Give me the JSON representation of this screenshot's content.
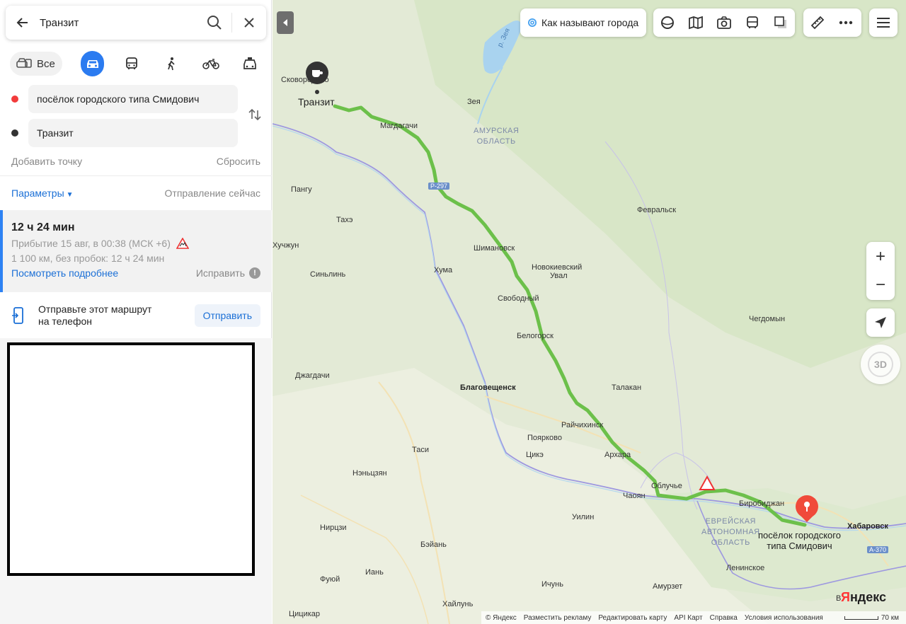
{
  "search": {
    "query": "Транзит"
  },
  "modes": {
    "all_label": "Все"
  },
  "route_from": "посёлок городского типа Смидович",
  "route_to": "Транзит",
  "add_point": "Добавить точку",
  "reset": "Сбросить",
  "parameters": "Параметры",
  "departure": "Отправление сейчас",
  "route": {
    "duration": "12 ч 24 мин",
    "arrival": "Прибытие 15 авг, в 00:38 (МСК +6)",
    "distance": "1 100 км, без пробок: 12 ч 24 мин",
    "details_link": "Посмотреть подробнее",
    "fix_label": "Исправить"
  },
  "send": {
    "text_line1": "Отправьте этот маршрут",
    "text_line2": "на телефон",
    "button": "Отправить"
  },
  "map": {
    "promo_label": "Как называют города",
    "origin_label": "Транзит",
    "dest_label_line1": "посёлок городского",
    "dest_label_line2": "типа Смидович",
    "road_badge": "Р-297",
    "road_badge2": "А-370",
    "compass_label": "3D",
    "logo_y": "Я",
    "logo_rest": "ндекс",
    "scale_label": "70 км",
    "footer": [
      "© Яндекс",
      "Разместить рекламу",
      "Редактировать карту",
      "API Карт",
      "Справка",
      "Условия использования"
    ],
    "cities": {
      "skovorodino": "Сковородино",
      "zeya": "Зея",
      "magdagachi": "Магдагачи",
      "pangu": "Пангу",
      "tahe": "Тахэ",
      "huzhun": "Хучжун",
      "sinlin": "Синьлинь",
      "huma": "Хума",
      "shimanovsk": "Шимановск",
      "novokievsky": "Новокиевский",
      "uval": "Увал",
      "svobodny": "Свободный",
      "belogorsk": "Белогорск",
      "fevralsk": "Февральск",
      "chegdomyn": "Чегдомын",
      "dzhagdachi": "Джагдачи",
      "blagoveshchensk": "Благовещенск",
      "talakan": "Талакан",
      "raichikhinsk": "Райчихинск",
      "poyarkovo": "Поярково",
      "tsike": "Цикэ",
      "tasi": "Таси",
      "arhara": "Архара",
      "neniszyan": "Нэньцзян",
      "chaoyan": "Чаоян",
      "obluchye": "Облучье",
      "birobidzhan": "Биробиджан",
      "khabarovsk": "Хабаровск",
      "uilin": "Уилин",
      "nirtszi": "Нирцзи",
      "beyan": "Бэйань",
      "ian": "Иань",
      "fuyuy": "Фуюй",
      "leninskoe": "Ленинское",
      "ichun": "Ичунь",
      "amurzet": "Амурзет",
      "tsitsikar": "Цицикар",
      "hailun": "Хайлунь",
      "v": "В"
    },
    "regions": {
      "amur_line1": "АМУРСКАЯ",
      "amur_line2": "ОБЛАСТЬ",
      "jao_line1": "ЕВРЕЙСКАЯ",
      "jao_line2": "АВТОНОМНАЯ",
      "jao_line3": "ОБЛАСТЬ"
    },
    "river_label": "р. Зея",
    "route_color": "#6cc04a",
    "dest_marker_color": "#f04a3a"
  },
  "colors": {
    "link": "#1a6fd6",
    "accent": "#2b7bf0",
    "from_dot": "#f23b3b",
    "to_dot": "#333333"
  }
}
